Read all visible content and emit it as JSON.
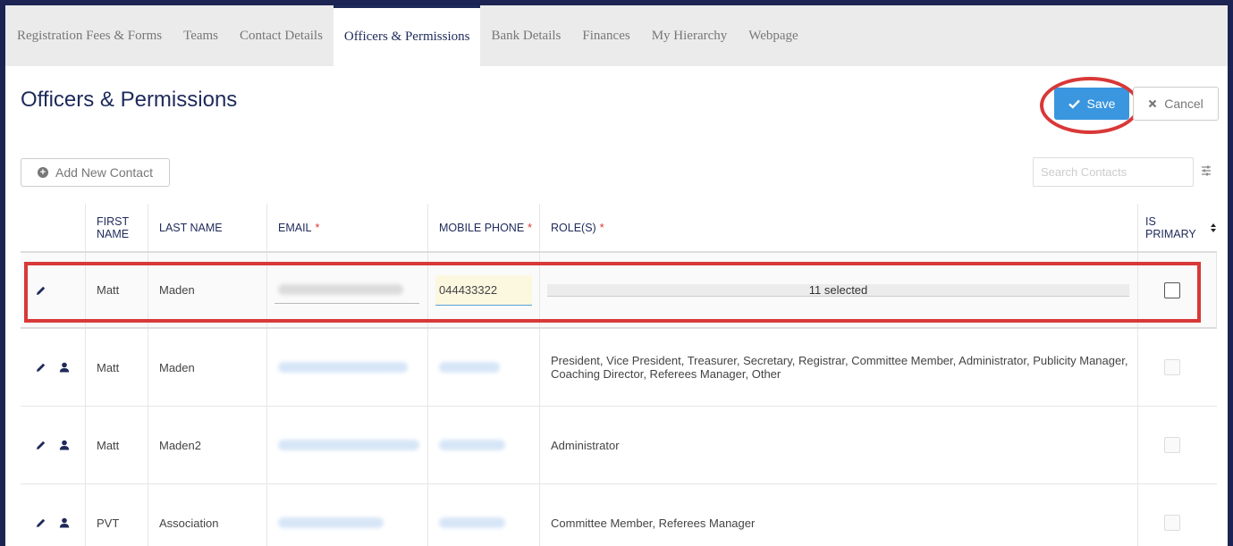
{
  "tabs": [
    {
      "label": "Registration Fees & Forms",
      "active": false
    },
    {
      "label": "Teams",
      "active": false
    },
    {
      "label": "Contact Details",
      "active": false
    },
    {
      "label": "Officers & Permissions",
      "active": true
    },
    {
      "label": "Bank Details",
      "active": false
    },
    {
      "label": "Finances",
      "active": false
    },
    {
      "label": "My Hierarchy",
      "active": false
    },
    {
      "label": "Webpage",
      "active": false
    }
  ],
  "page": {
    "title": "Officers & Permissions",
    "save_label": "Save",
    "cancel_label": "Cancel",
    "add_contact_label": "Add New Contact",
    "search_placeholder": "Search Contacts"
  },
  "table": {
    "headers": {
      "first_name": "FIRST NAME",
      "last_name": "LAST NAME",
      "email": "EMAIL",
      "mobile_phone": "MOBILE PHONE",
      "roles": "ROLE(S)",
      "is_primary": "IS PRIMARY",
      "required_mark": "*"
    },
    "edit_row": {
      "first_name": "Matt",
      "last_name": "Maden",
      "mobile_phone": "044433322",
      "roles_summary": "11 selected"
    },
    "rows": [
      {
        "first_name": "Matt",
        "last_name": "Maden",
        "roles": "President, Vice President, Treasurer, Secretary, Registrar, Committee Member, Administrator, Publicity Manager, Coaching Director, Referees Manager, Other"
      },
      {
        "first_name": "Matt",
        "last_name": "Maden2",
        "roles": "Administrator"
      },
      {
        "first_name": "PVT",
        "last_name": "Association",
        "roles": "Committee Member, Referees Manager"
      }
    ]
  },
  "colors": {
    "accent": "#3a96de",
    "brand_navy": "#1e2a5a",
    "annotation_red": "#d93838"
  }
}
